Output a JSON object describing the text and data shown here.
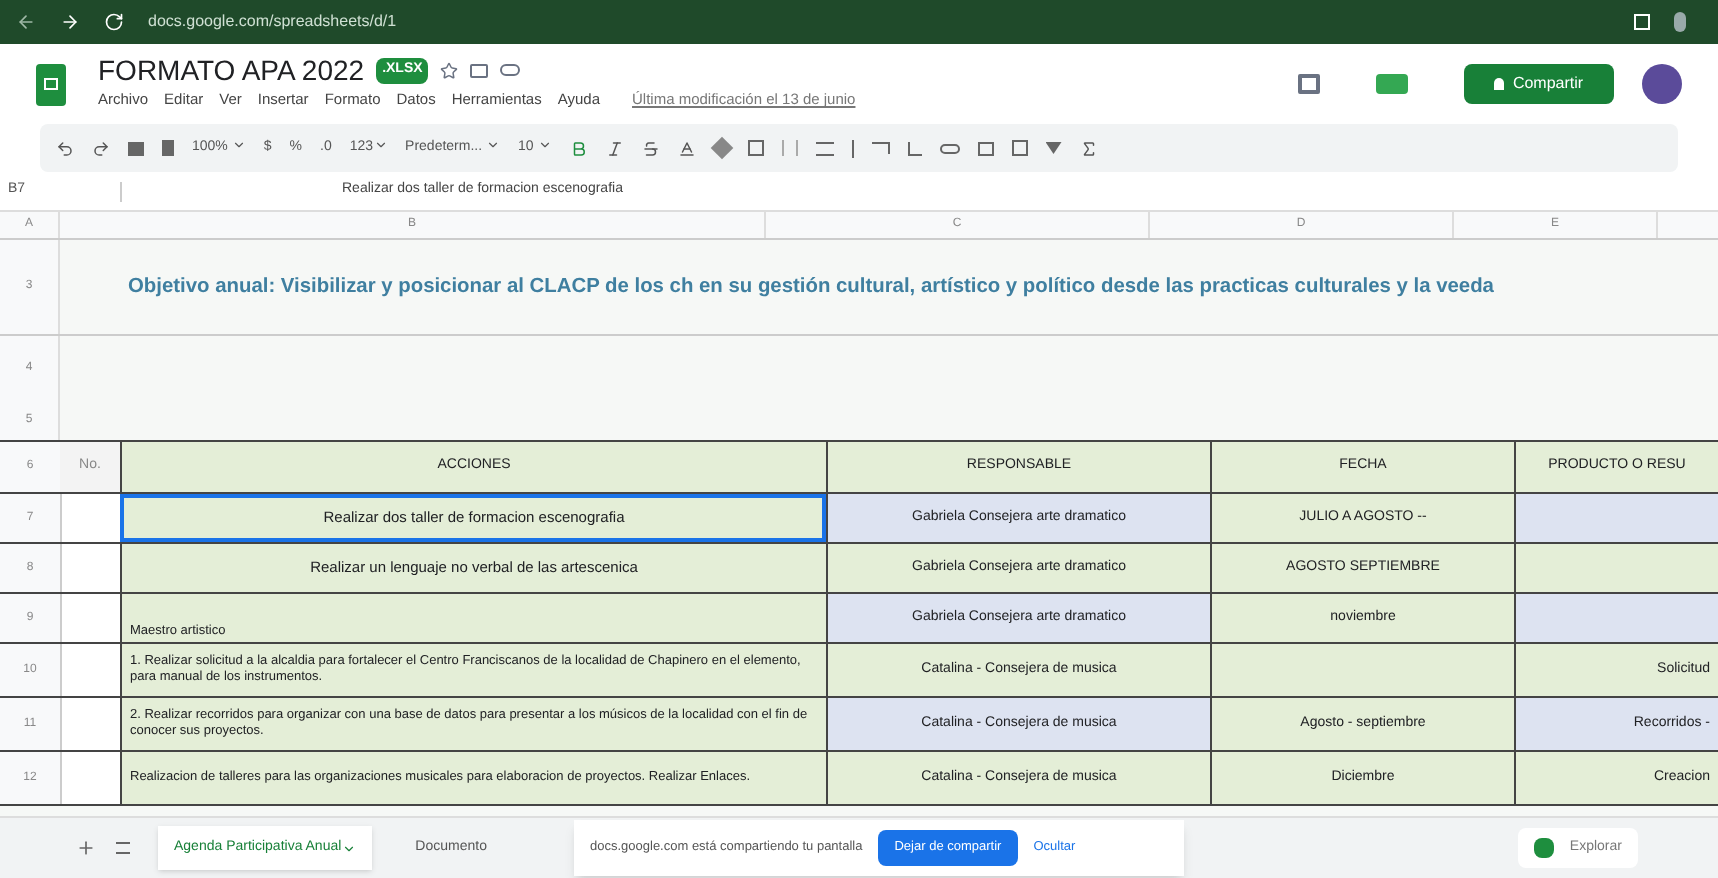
{
  "browser": {
    "url": "docs.google.com/spreadsheets/d/1"
  },
  "document": {
    "title": "FORMATO APA 2022",
    "badge": ".XLSX",
    "last_edit": "Última modificación el 13 de junio",
    "share_button": "Compartir"
  },
  "menu": [
    "Archivo",
    "Editar",
    "Ver",
    "Insertar",
    "Formato",
    "Datos",
    "Herramientas",
    "Ayuda"
  ],
  "toolbar": {
    "zoom": "100%",
    "currency": "$",
    "percent": "%",
    "decimals": ".0",
    "more_formats": "123",
    "font": "Predeterm...",
    "font_size": "10"
  },
  "formula_bar": {
    "cell": "B7",
    "value": "Realizar dos taller de formacion escenografia"
  },
  "columns": [
    "A",
    "B",
    "C",
    "D",
    "E"
  ],
  "objective": {
    "row": "3",
    "text": "Objetivo anual: Visibilizar y posicionar al CLACP de los ch en su gestión cultural, artístico y político desde las practicas culturales y la veeda"
  },
  "empty_rows": [
    "4",
    "5"
  ],
  "table": {
    "row": "6",
    "headers": [
      "No.",
      "ACCIONES",
      "RESPONSABLE",
      "FECHA",
      "PRODUCTO O RESU"
    ],
    "rows": [
      {
        "row": "7",
        "selected": true,
        "accion": "Realizar dos taller de formacion escenografia",
        "kind": "centered",
        "responsable": "Gabriela Consejera arte dramatico",
        "fecha": "JULIO A AGOSTO --",
        "producto": ""
      },
      {
        "row": "8",
        "selected": false,
        "accion": "Realizar un lenguaje no verbal de las artescenica",
        "kind": "centered",
        "responsable": "Gabriela Consejera arte dramatico",
        "fecha": "AGOSTO SEPTIEMBRE",
        "producto": ""
      },
      {
        "row": "9",
        "selected": false,
        "accion": "Maestro artistico",
        "kind": "note",
        "responsable": "Gabriela Consejera arte dramatico",
        "fecha": "noviembre",
        "producto": ""
      },
      {
        "row": "10",
        "selected": false,
        "accion": "1. Realizar solicitud a la alcaldia para fortalecer el Centro Franciscanos de la localidad de Chapinero en el elemento, para manual de los instrumentos.",
        "kind": "paragraph",
        "responsable": "Catalina - Consejera de musica",
        "fecha": "",
        "producto": "Solicitud"
      },
      {
        "row": "11",
        "selected": false,
        "accion": "2. Realizar recorridos para organizar con una base de datos para presentar a los músicos de la localidad con el fin de conocer sus proyectos.",
        "kind": "paragraph",
        "responsable": "Catalina - Consejera de musica",
        "fecha": "Agosto - septiembre",
        "producto": "Recorridos -"
      },
      {
        "row": "12",
        "selected": false,
        "accion": "Realizacion de talleres para las organizaciones musicales para elaboracion de proyectos. Realizar Enlaces.",
        "kind": "paragraph",
        "responsable": "Catalina - Consejera de musica",
        "fecha": "Diciembre",
        "producto": "Creacion"
      }
    ]
  },
  "sheet_tabs": [
    {
      "label": "Agenda Participativa Anual",
      "selected": true
    },
    {
      "label": "Documento",
      "selected": false
    }
  ],
  "share_notice": {
    "text": "docs.google.com está compartiendo tu pantalla",
    "stop_button": "Dejar de compartir",
    "hide_button": "Ocultar"
  },
  "explore_button": "Explorar"
}
